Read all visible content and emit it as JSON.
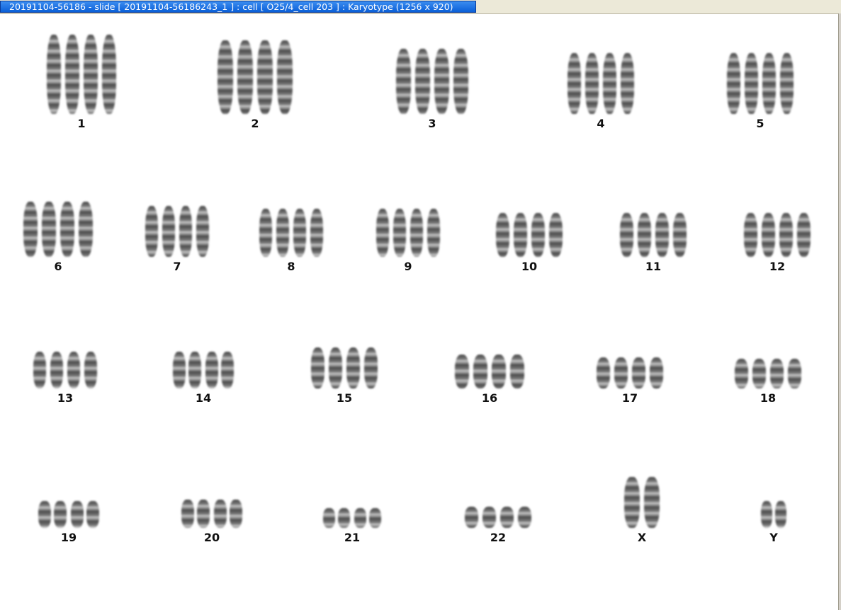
{
  "window": {
    "title": "20191104-56186 - slide [  20191104-56186243_1 ] : cell [ O25/4_cell 203 ] : Karyotype  (1256 x 920)"
  },
  "karyotype": {
    "chromosomes": [
      {
        "id": "1",
        "label": "1"
      },
      {
        "id": "2",
        "label": "2"
      },
      {
        "id": "3",
        "label": "3"
      },
      {
        "id": "4",
        "label": "4"
      },
      {
        "id": "5",
        "label": "5"
      },
      {
        "id": "6",
        "label": "6"
      },
      {
        "id": "7",
        "label": "7"
      },
      {
        "id": "8",
        "label": "8"
      },
      {
        "id": "9",
        "label": "9"
      },
      {
        "id": "10",
        "label": "10"
      },
      {
        "id": "11",
        "label": "11"
      },
      {
        "id": "12",
        "label": "12"
      },
      {
        "id": "13",
        "label": "13"
      },
      {
        "id": "14",
        "label": "14"
      },
      {
        "id": "15",
        "label": "15"
      },
      {
        "id": "16",
        "label": "16"
      },
      {
        "id": "17",
        "label": "17"
      },
      {
        "id": "18",
        "label": "18"
      },
      {
        "id": "19",
        "label": "19"
      },
      {
        "id": "20",
        "label": "20"
      },
      {
        "id": "21",
        "label": "21"
      },
      {
        "id": "22",
        "label": "22"
      },
      {
        "id": "X",
        "label": "X"
      },
      {
        "id": "Y",
        "label": "Y"
      }
    ]
  }
}
